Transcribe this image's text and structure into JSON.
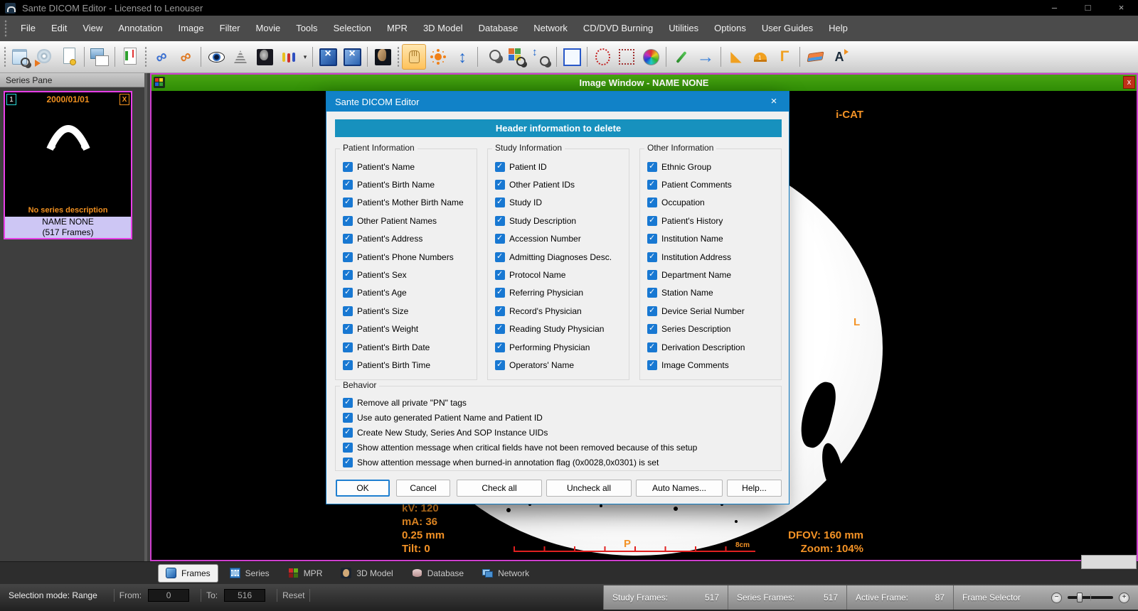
{
  "titlebar": {
    "title": "Sante DICOM Editor - Licensed to Lenouser",
    "minimize": "–",
    "maximize": "□",
    "close": "×"
  },
  "menu": {
    "items": [
      "File",
      "Edit",
      "View",
      "Annotation",
      "Image",
      "Filter",
      "Movie",
      "Tools",
      "Selection",
      "MPR",
      "3D Model",
      "Database",
      "Network",
      "CD/DVD Burning",
      "Utilities",
      "Options",
      "User Guides",
      "Help"
    ]
  },
  "toolbar": {
    "items": [
      {
        "name": "toolbar-grip",
        "kind": "grip"
      },
      {
        "name": "open-study-icon",
        "kind": "openstudy"
      },
      {
        "name": "cd-burn-icon",
        "kind": "cdburn"
      },
      {
        "name": "anonymize-document-icon",
        "kind": "docinfo"
      },
      {
        "name": "toolbar-separator",
        "kind": "sep"
      },
      {
        "name": "print-images-icon",
        "kind": "export"
      },
      {
        "name": "toolbar-separator",
        "kind": "sep"
      },
      {
        "name": "report-editor-icon",
        "kind": "report"
      },
      {
        "name": "toolbar-grip",
        "kind": "grip"
      },
      {
        "name": "link-series-icon",
        "kind": "linkblue"
      },
      {
        "name": "link-window-level-icon",
        "kind": "linkorange"
      },
      {
        "name": "toolbar-separator",
        "kind": "sep"
      },
      {
        "name": "show-overlays-eye-icon",
        "kind": "eye"
      },
      {
        "name": "window-level-histogram-icon",
        "kind": "levels"
      },
      {
        "name": "mri-presets-icon",
        "kind": "mrihead"
      },
      {
        "name": "color-presets-icon",
        "kind": "presets"
      },
      {
        "name": "presets-dropdown-arrow",
        "kind": "dd"
      },
      {
        "name": "toolbar-separator",
        "kind": "sep"
      },
      {
        "name": "fit-image-icon",
        "kind": "fitw"
      },
      {
        "name": "fit-window-icon",
        "kind": "fith"
      },
      {
        "name": "toolbar-separator",
        "kind": "sep"
      },
      {
        "name": "3d-head-icon",
        "kind": "head3d"
      },
      {
        "name": "toolbar-grip",
        "kind": "grip"
      },
      {
        "name": "pan-hand-icon",
        "kind": "hand",
        "active": true
      },
      {
        "name": "brightness-sun-icon",
        "kind": "sun"
      },
      {
        "name": "contrast-updown-icon",
        "kind": "updown"
      },
      {
        "name": "toolbar-separator",
        "kind": "sep"
      },
      {
        "name": "magnifier-icon",
        "kind": "mag"
      },
      {
        "name": "zoom-region-icon",
        "kind": "magcolor"
      },
      {
        "name": "zoom-tool-icon",
        "kind": "magzoom"
      },
      {
        "name": "toolbar-separator",
        "kind": "sep"
      },
      {
        "name": "rectangle-select-icon",
        "kind": "rectsel"
      },
      {
        "name": "toolbar-separator",
        "kind": "sep"
      },
      {
        "name": "ellipse-roi-icon",
        "kind": "roiellipse"
      },
      {
        "name": "rectangle-roi-icon",
        "kind": "roirect"
      },
      {
        "name": "color-palette-icon",
        "kind": "wheel"
      },
      {
        "name": "toolbar-separator",
        "kind": "sep"
      },
      {
        "name": "pencil-icon",
        "kind": "pencil"
      },
      {
        "name": "arrow-annotation-icon",
        "kind": "arrowblue"
      },
      {
        "name": "toolbar-separator",
        "kind": "sep"
      },
      {
        "name": "ruler-icon",
        "kind": "setsquare"
      },
      {
        "name": "protractor-icon",
        "kind": "protractor"
      },
      {
        "name": "angle-ruler-icon",
        "kind": "cornerruler"
      },
      {
        "name": "toolbar-separator",
        "kind": "sep"
      },
      {
        "name": "eraser-icon",
        "kind": "eraser"
      },
      {
        "name": "text-annotation-icon",
        "kind": "texttool"
      }
    ]
  },
  "series_pane": {
    "title": "Series Pane",
    "thumb": {
      "index": "1",
      "date": "2000/01/01",
      "close": "X",
      "description": "No series description",
      "name": "NAME NONE",
      "frames": "(517 Frames)"
    }
  },
  "image_window": {
    "title": "Image Window - NAME NONE",
    "close": "x",
    "overlays": {
      "scanner": "i-CAT",
      "orientation_right": "L",
      "orientation_bottom": "P",
      "kv": "kV: 120",
      "ma": "mA: 36",
      "thickness": "0.25 mm",
      "tilt": "Tilt: 0",
      "dfov": "DFOV: 160 mm",
      "zoom": "Zoom: 104%",
      "ruler_label": "8cm"
    }
  },
  "dialog": {
    "title": "Sante DICOM Editor",
    "close": "×",
    "banner": "Header information to delete",
    "groups": [
      {
        "label": "Patient Information",
        "items": [
          "Patient's Name",
          "Patient's Birth Name",
          "Patient's Mother Birth Name",
          "Other Patient Names",
          "Patient's Address",
          "Patient's Phone Numbers",
          "Patient's Sex",
          "Patient's Age",
          "Patient's Size",
          "Patient's Weight",
          "Patient's Birth Date",
          "Patient's Birth Time"
        ]
      },
      {
        "label": "Study Information",
        "items": [
          "Patient ID",
          "Other Patient IDs",
          "Study ID",
          "Study Description",
          "Accession Number",
          "Admitting Diagnoses Desc.",
          "Protocol Name",
          "Referring Physician",
          "Record's Physician",
          "Reading Study Physician",
          "Performing Physician",
          "Operators' Name"
        ]
      },
      {
        "label": "Other Information",
        "items": [
          "Ethnic Group",
          "Patient Comments",
          "Occupation",
          "Patient's History",
          "Institution Name",
          "Institution Address",
          "Department Name",
          "Station Name",
          "Device Serial Number",
          "Series Description",
          "Derivation Description",
          "Image Comments"
        ]
      }
    ],
    "behavior": {
      "label": "Behavior",
      "items": [
        "Remove all private \"PN\" tags",
        "Use auto generated Patient Name and Patient ID",
        "Create New Study, Series And SOP Instance UIDs",
        "Show attention message when critical fields have not been removed because of this setup",
        "Show attention message when burned-in annotation flag (0x0028,0x0301) is set"
      ]
    },
    "buttons": {
      "ok": "OK",
      "cancel": "Cancel",
      "check_all": "Check all",
      "uncheck_all": "Uncheck all",
      "auto_names": "Auto Names...",
      "help": "Help..."
    }
  },
  "tabs": {
    "items": [
      {
        "name": "tab-frames",
        "label": "Frames",
        "kind": "frames",
        "active": true
      },
      {
        "name": "tab-series",
        "label": "Series",
        "kind": "series"
      },
      {
        "name": "tab-mpr",
        "label": "MPR",
        "kind": "mpr"
      },
      {
        "name": "tab-3d-model",
        "label": "3D Model",
        "kind": "model3d"
      },
      {
        "name": "tab-database",
        "label": "Database",
        "kind": "database"
      },
      {
        "name": "tab-network",
        "label": "Network",
        "kind": "network"
      }
    ]
  },
  "status_bar": {
    "selection_mode": "Selection mode: Range",
    "from_label": "From:",
    "from_value": "0",
    "to_label": "To:",
    "to_value": "516",
    "reset_label": "Reset",
    "study_frames_label": "Study Frames:",
    "study_frames_value": "517",
    "series_frames_label": "Series Frames:",
    "series_frames_value": "517",
    "active_frame_label": "Active Frame:",
    "active_frame_value": "87",
    "frame_selector_label": "Frame Selector",
    "minus": "−",
    "plus": "+"
  },
  "colors": {
    "image_window_green": "#3a9a0b",
    "selection_magenta": "#cf3fcf",
    "dialog_title_blue": "#1182c8",
    "banner_teal": "#1791be",
    "checkbox_blue": "#1878d2",
    "overlay_orange": "#f49326"
  }
}
